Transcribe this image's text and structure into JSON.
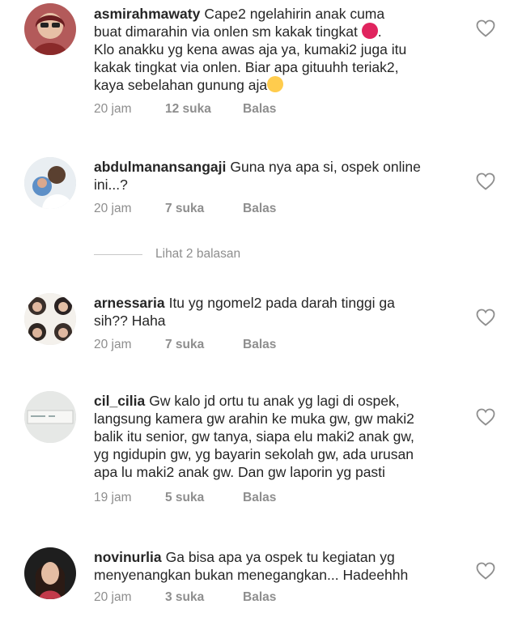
{
  "comments": [
    {
      "username": "asmirahmawaty",
      "text_lines": [
        "Cape2 ngelahirin anak cuma",
        "buat dimarahin via onlen sm kakak tingkat",
        "Klo anakku yg kena awas aja ya, kumaki2 juga itu",
        "kakak tingkat via onlen. Biar apa gituuhh teriak2,",
        "kaya sebelahan gunung aja"
      ],
      "time": "20 jam",
      "likes": "12 suka",
      "reply": "Balas"
    },
    {
      "username": "abdulmanansangaji",
      "text_lines": [
        "Guna nya apa si, ospek online",
        "ini...?"
      ],
      "time": "20 jam",
      "likes": "7 suka",
      "reply": "Balas"
    },
    {
      "username": "arnessaria",
      "text_lines": [
        "Itu yg ngomel2 pada darah tinggi ga",
        "sih?? Haha"
      ],
      "time": "20 jam",
      "likes": "7 suka",
      "reply": "Balas"
    },
    {
      "username": "cil_cilia",
      "text_lines": [
        "Gw kalo jd ortu tu anak yg lagi di ospek,",
        "langsung kamera gw arahin ke muka gw, gw maki2",
        "balik itu senior, gw tanya, siapa elu maki2 anak gw,",
        "yg ngidupin gw, yg bayarin sekolah gw, ada urusan",
        "apa lu maki2 anak gw. Dan gw laporin yg pasti"
      ],
      "time": "19 jam",
      "likes": "5 suka",
      "reply": "Balas"
    },
    {
      "username": "novinurlia",
      "text_lines": [
        "Ga bisa apa ya ospek tu kegiatan yg",
        "menyenangkan bukan menegangkan... Hadeehhh"
      ],
      "time": "20 jam",
      "likes": "3 suka",
      "reply": "Balas"
    }
  ],
  "view_replies": "Lihat 2 balasan",
  "icons": {
    "like": "heart-outline-icon",
    "emoji_1": "angry-face-emoji",
    "emoji_2": "eye-roll-emoji"
  },
  "colors": {
    "text": "#262626",
    "meta": "#8e8e8e",
    "heart_stroke": "#8e8e8e"
  }
}
